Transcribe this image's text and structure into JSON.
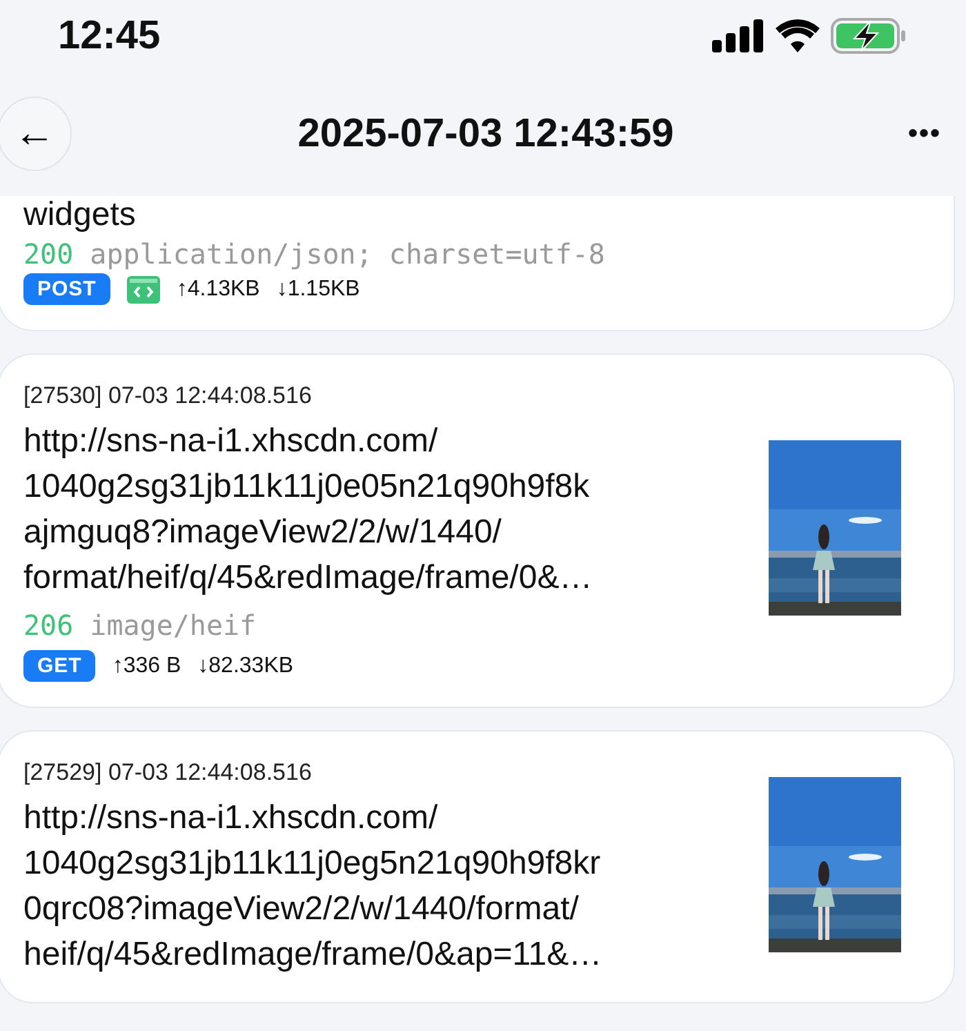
{
  "status_bar": {
    "time": "12:45"
  },
  "header": {
    "back": "←",
    "title": "2025-07-03 12:43:59",
    "more": "•••"
  },
  "requests": [
    {
      "url_lines": [
        "widgets"
      ],
      "status": "200",
      "content_type": "application/json; charset=utf-8",
      "method": "POST",
      "code_preview": true,
      "upload": "↑4.13KB",
      "download": "↓1.15KB"
    },
    {
      "meta": "[27530] 07-03 12:44:08.516",
      "url_lines": [
        "http://sns-na-i1.xhscdn.com/",
        "1040g2sg31jb11k11j0e05n21q90h9f8k",
        "ajmguq8?imageView2/2/w/1440/",
        "format/heif/q/45&redImage/frame/0&…"
      ],
      "status": "206",
      "content_type": "image/heif",
      "method": "GET",
      "upload": "↑336 B",
      "download": "↓82.33KB"
    },
    {
      "meta": "[27529] 07-03 12:44:08.516",
      "url_lines": [
        "http://sns-na-i1.xhscdn.com/",
        "1040g2sg31jb11k11j0eg5n21q90h9f8kr",
        "0qrc08?imageView2/2/w/1440/format/",
        "heif/q/45&redImage/frame/0&ap=11&…"
      ]
    }
  ]
}
